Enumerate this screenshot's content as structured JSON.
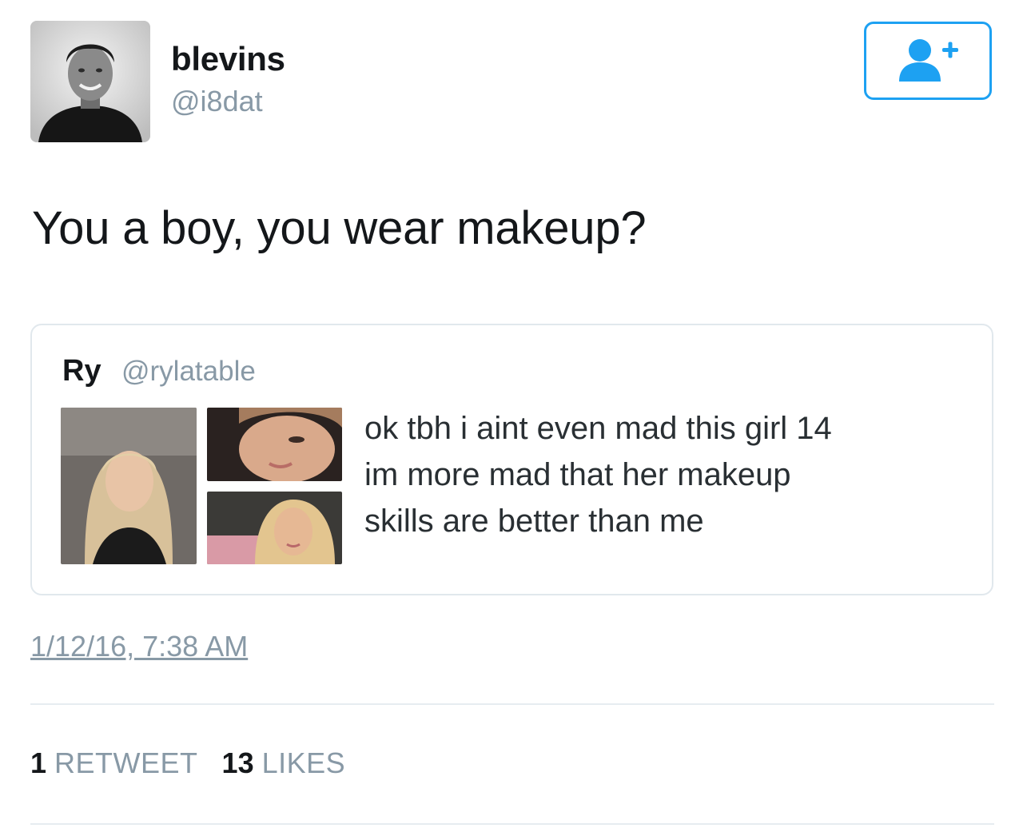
{
  "author": {
    "display_name": "blevins",
    "handle": "@i8dat",
    "avatar_icon": "profile-photo"
  },
  "follow_button": {
    "icon": "follow-user-plus-icon",
    "color": "#1da1f2"
  },
  "tweet": {
    "text": "You a boy, you wear makeup?",
    "timestamp": "1/12/16, 7:38 AM"
  },
  "quoted_tweet": {
    "author_name": "Ry",
    "author_handle": "@rylatable",
    "text": "ok tbh i aint even mad this girl 14\nim more mad that her makeup\nskills are better than me",
    "media": [
      "photo-selfie-car",
      "photo-closeup-face",
      "photo-selfie-pink"
    ]
  },
  "stats": {
    "retweets_count": "1",
    "retweets_label": "RETWEET",
    "likes_count": "13",
    "likes_label": "LIKES"
  },
  "colors": {
    "text_primary": "#14171a",
    "text_secondary": "#8899a6",
    "accent": "#1da1f2",
    "border": "#e1e8ed"
  }
}
